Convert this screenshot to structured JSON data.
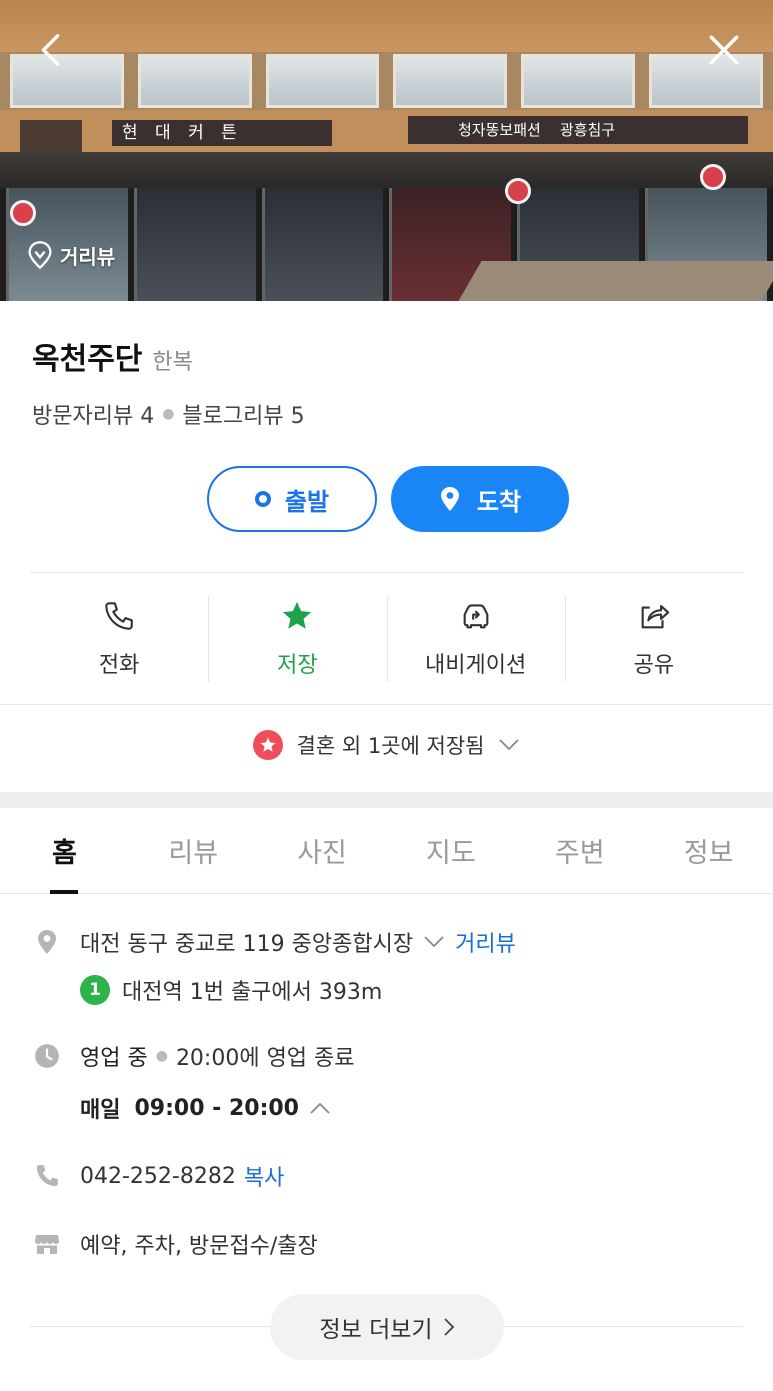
{
  "hero": {
    "storefront_signs": [
      "현 대 커 튼",
      "청자똥보패션",
      "광흥침구"
    ],
    "roadview_label": "거리뷰",
    "back_icon": "chevron-left-icon",
    "close_icon": "close-icon"
  },
  "place": {
    "name": "옥천주단",
    "category": "한복",
    "visitor_reviews": "방문자리뷰 4",
    "blog_reviews": "블로그리뷰 5"
  },
  "route": {
    "depart_label": "출발",
    "arrive_label": "도착"
  },
  "actions": [
    {
      "label": "전화",
      "icon": "phone-icon"
    },
    {
      "label": "저장",
      "icon": "star-icon"
    },
    {
      "label": "내비게이션",
      "icon": "car-navigation-icon"
    },
    {
      "label": "공유",
      "icon": "share-icon"
    }
  ],
  "saved": {
    "text": "결혼 외 1곳에 저장됨"
  },
  "tabs": [
    "홈",
    "리뷰",
    "사진",
    "지도",
    "주변",
    "정보"
  ],
  "info": {
    "address": "대전 동구 중교로 119 중앙종합시장",
    "roadview_link": "거리뷰",
    "subway_line": "1",
    "subway_text": "대전역 1번 출구에서 393m",
    "status": "영업 중",
    "status_detail": "20:00에 영업 종료",
    "hours_day": "매일",
    "hours_time": "09:00 - 20:00",
    "phone": "042-252-8282",
    "copy_label": "복사",
    "facilities": "예약, 주차, 방문접수/출장",
    "more_label": "정보 더보기"
  },
  "colors": {
    "accent_blue": "#1a86f5",
    "saved_green": "#1fa34a",
    "badge_red": "#f04d5a",
    "subway_green": "#2db34a"
  }
}
